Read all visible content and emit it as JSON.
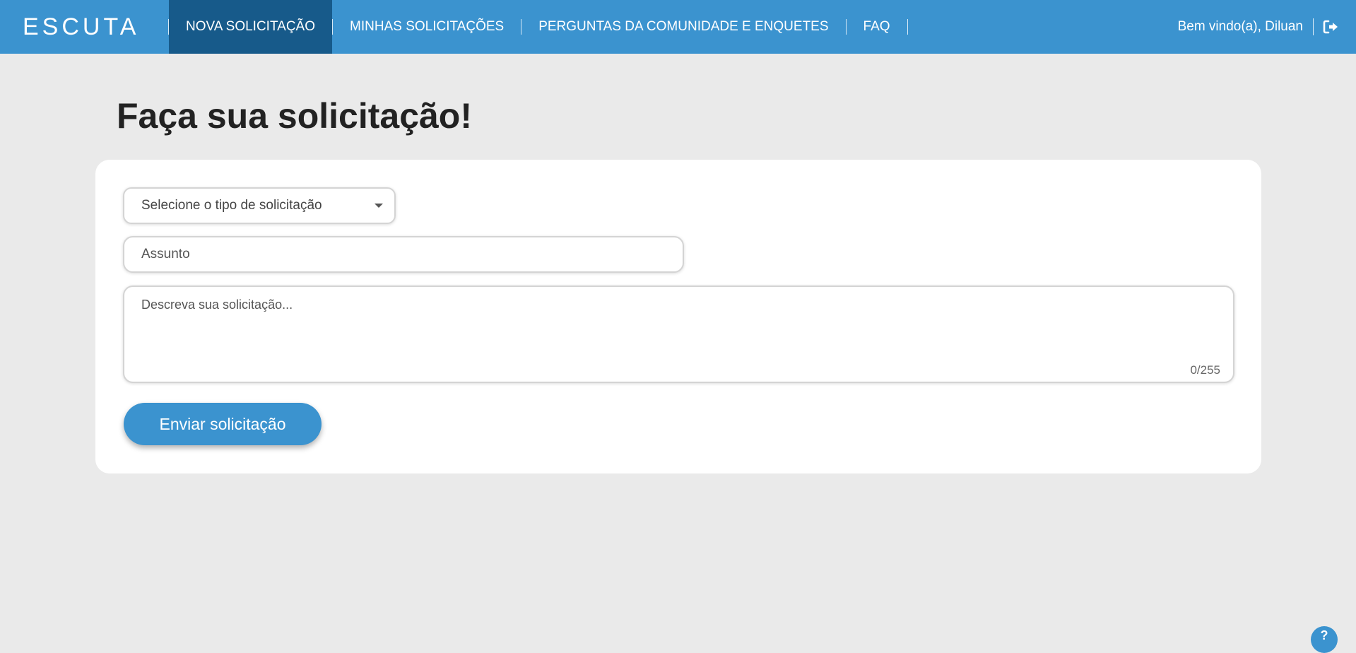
{
  "header": {
    "logo_text": "ESCUTA",
    "nav": [
      {
        "label": "NOVA SOLICITAÇÃO",
        "active": true
      },
      {
        "label": "MINHAS SOLICITAÇÕES",
        "active": false
      },
      {
        "label": "PERGUNTAS DA COMUNIDADE E ENQUETES",
        "active": false
      },
      {
        "label": "FAQ",
        "active": false
      }
    ],
    "welcome_text": "Bem vindo(a), Diluan",
    "logout_icon": "logout-icon"
  },
  "main": {
    "title": "Faça sua solicitação!",
    "form": {
      "type_select_placeholder": "Selecione o tipo de solicitação",
      "subject_placeholder": "Assunto",
      "description_placeholder": "Descreva sua solicitação...",
      "char_counter": "0/255",
      "submit_label": "Enviar solicitação"
    }
  },
  "help_button_label": "?",
  "colors": {
    "primary": "#3b93cf",
    "nav_active": "#175a8a",
    "background": "#eaeaea",
    "card": "#ffffff"
  }
}
